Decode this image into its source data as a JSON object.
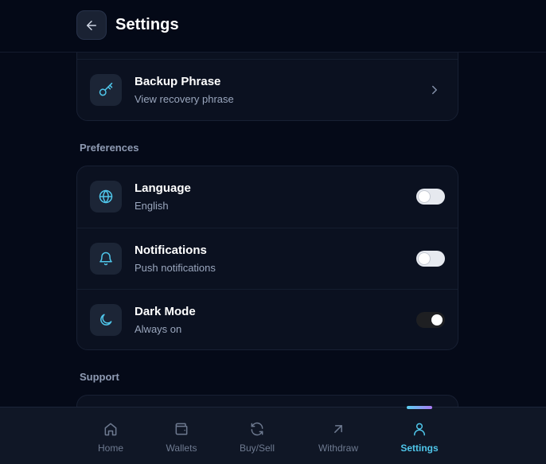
{
  "header": {
    "title": "Settings"
  },
  "security": {
    "backup": {
      "title": "Backup Phrase",
      "subtitle": "View recovery phrase"
    }
  },
  "preferences": {
    "label": "Preferences",
    "items": [
      {
        "title": "Language",
        "subtitle": "English",
        "enabled": false
      },
      {
        "title": "Notifications",
        "subtitle": "Push notifications",
        "enabled": false
      },
      {
        "title": "Dark Mode",
        "subtitle": "Always on",
        "enabled": true
      }
    ]
  },
  "support": {
    "label": "Support"
  },
  "nav": {
    "items": [
      {
        "label": "Home",
        "icon": "home-icon"
      },
      {
        "label": "Wallets",
        "icon": "wallet-icon"
      },
      {
        "label": "Buy/Sell",
        "icon": "refresh-icon"
      },
      {
        "label": "Withdraw",
        "icon": "arrow-up-right-icon"
      },
      {
        "label": "Settings",
        "icon": "user-icon",
        "active": true
      }
    ]
  },
  "colors": {
    "accent": "#4fc6ea",
    "background": "#050a18",
    "card": "#0b1120"
  }
}
